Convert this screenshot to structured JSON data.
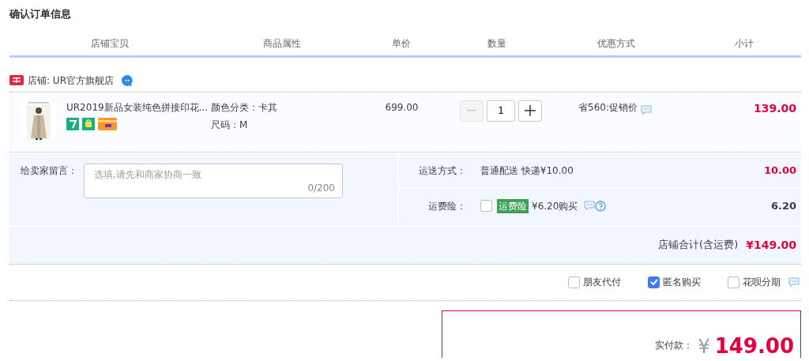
{
  "page_title": "确认订单信息",
  "columns": [
    "店铺宝贝",
    "商品属性",
    "单价",
    "数量",
    "优惠方式",
    "小计"
  ],
  "shop": {
    "label": "店铺: UR官方旗舰店"
  },
  "item": {
    "title": "UR2019新品女装纯色拼接印花...",
    "attributes": [
      "颜色分类：卡其",
      "尺码：M"
    ],
    "price": "699.00",
    "quantity": "1",
    "decrease_disabled": true,
    "promo": "省560:促销价",
    "subtotal": "139.00"
  },
  "message": {
    "label": "给卖家留言：",
    "placeholder": "选填,请先和商家协商一致",
    "counter": "0/200"
  },
  "shipping": {
    "label": "运送方式：",
    "option": "普通配送 快递¥10.00",
    "amount": "10.00"
  },
  "insurance": {
    "label": "运费险：",
    "checked": false,
    "tag": "运费险",
    "text": "¥6.20购买",
    "amount": "6.20"
  },
  "shop_total": {
    "label": "店铺合计(含运费)",
    "amount": "¥149.00"
  },
  "options": [
    {
      "label": "朋友代付",
      "checked": false,
      "kind": "plain"
    },
    {
      "label": "匿名购买",
      "checked": true,
      "kind": "plain"
    },
    {
      "label": "花呗分期",
      "checked": false,
      "kind": "with_note"
    }
  ],
  "payment": {
    "label": "实付款：",
    "currency": "¥",
    "amount": "149.00"
  }
}
